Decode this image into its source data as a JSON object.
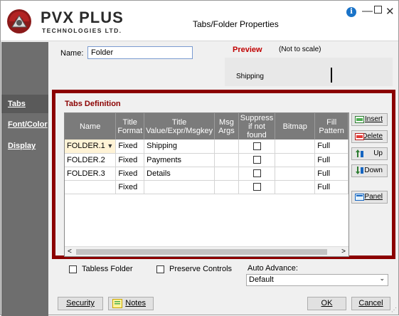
{
  "window": {
    "title": "Tabs/Folder Properties",
    "logo": {
      "brand": "PVX PLUS",
      "subtitle": "TECHNOLOGIES LTD."
    }
  },
  "leftnav": {
    "items": [
      {
        "label": "Tabs",
        "active": true
      },
      {
        "label": "Font/Color",
        "active": false
      },
      {
        "label": "Display",
        "active": false
      }
    ]
  },
  "name_field": {
    "label": "Name:",
    "value": "Folder"
  },
  "preview": {
    "title": "Preview",
    "note": "(Not to scale)",
    "tab_label": "Shipping"
  },
  "tabs_definition": {
    "title": "Tabs Definition",
    "columns": [
      "Name",
      "Title Format",
      "Title Value/Expr/Msgkey",
      "Msg Args",
      "Suppress if not found",
      "Bitmap",
      "Fill Pattern"
    ],
    "rows": [
      {
        "name": "FOLDER.1",
        "format": "Fixed",
        "value": "Shipping",
        "args": "",
        "suppress": false,
        "bitmap": "",
        "fill": "Full",
        "selected": true
      },
      {
        "name": "FOLDER.2",
        "format": "Fixed",
        "value": "Payments",
        "args": "",
        "suppress": false,
        "bitmap": "",
        "fill": "Full",
        "selected": false
      },
      {
        "name": "FOLDER.3",
        "format": "Fixed",
        "value": "Details",
        "args": "",
        "suppress": false,
        "bitmap": "",
        "fill": "Full",
        "selected": false
      },
      {
        "name": "",
        "format": "Fixed",
        "value": "",
        "args": "",
        "suppress": false,
        "bitmap": "",
        "fill": "Full",
        "selected": false
      }
    ],
    "scroll_left": "<",
    "scroll_right": ">"
  },
  "side_buttons": {
    "insert": "Insert",
    "delete": "Delete",
    "up": "Up",
    "down": "Down",
    "panel": "Panel"
  },
  "options": {
    "tabless_folder": "Tabless Folder",
    "preserve_controls": "Preserve Controls",
    "auto_advance_label": "Auto Advance:",
    "auto_advance_value": "Default"
  },
  "footer": {
    "security": "Security",
    "notes": "Notes",
    "ok": "OK",
    "cancel": "Cancel"
  },
  "colors": {
    "frame_border": "#8b0000",
    "preview_title": "#c00000",
    "grid_header": "#7b7b7b",
    "leftnav": "#6e6e6e"
  }
}
